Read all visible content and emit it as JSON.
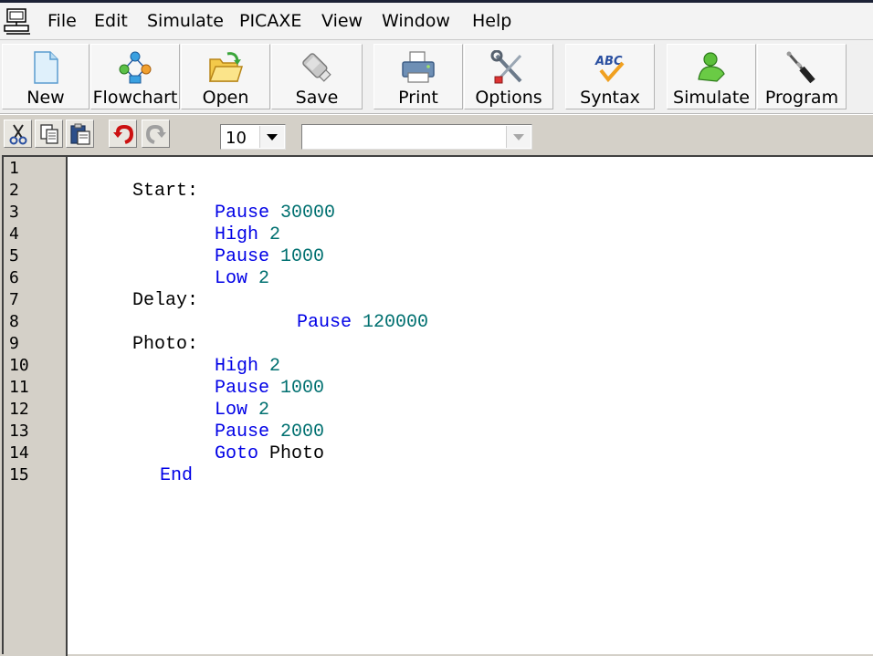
{
  "menu": [
    "File",
    "Edit",
    "Simulate",
    "PICAXE",
    "View",
    "Window",
    "Help"
  ],
  "toolbar": {
    "new": "New",
    "flowchart": "Flowchart",
    "open": "Open",
    "save": "Save",
    "print": "Print",
    "options": "Options",
    "syntax": "Syntax",
    "simulate": "Simulate",
    "program": "Program"
  },
  "format": {
    "font_size": "10",
    "font_name": ""
  },
  "editor": {
    "line_numbers": [
      "1",
      "2",
      "3",
      "4",
      "5",
      "6",
      "7",
      "8",
      "9",
      "10",
      "11",
      "12",
      "13",
      "14",
      "15"
    ],
    "lines": [
      {
        "label": "Start:"
      },
      {
        "keyword": "Pause",
        "arg": "30000"
      },
      {
        "keyword": "High",
        "arg": "2"
      },
      {
        "keyword": "Pause",
        "arg": "1000"
      },
      {
        "keyword": "Low",
        "arg": "2"
      },
      {
        "label": "Delay:"
      },
      {
        "keyword": "Pause",
        "arg": "120000"
      },
      {
        "label": "Photo:"
      },
      {
        "keyword": "High",
        "arg": "2"
      },
      {
        "keyword": "Pause",
        "arg": "1000"
      },
      {
        "keyword": "Low",
        "arg": "2"
      },
      {
        "keyword": "Pause",
        "arg": "2000"
      },
      {
        "keyword": "Goto",
        "arg": "Photo"
      },
      {
        "keyword": "End"
      }
    ]
  },
  "colors": {
    "keyword": "#0000e6",
    "number": "#007070",
    "label": "#000000",
    "gutter": "#d4d0c8"
  }
}
